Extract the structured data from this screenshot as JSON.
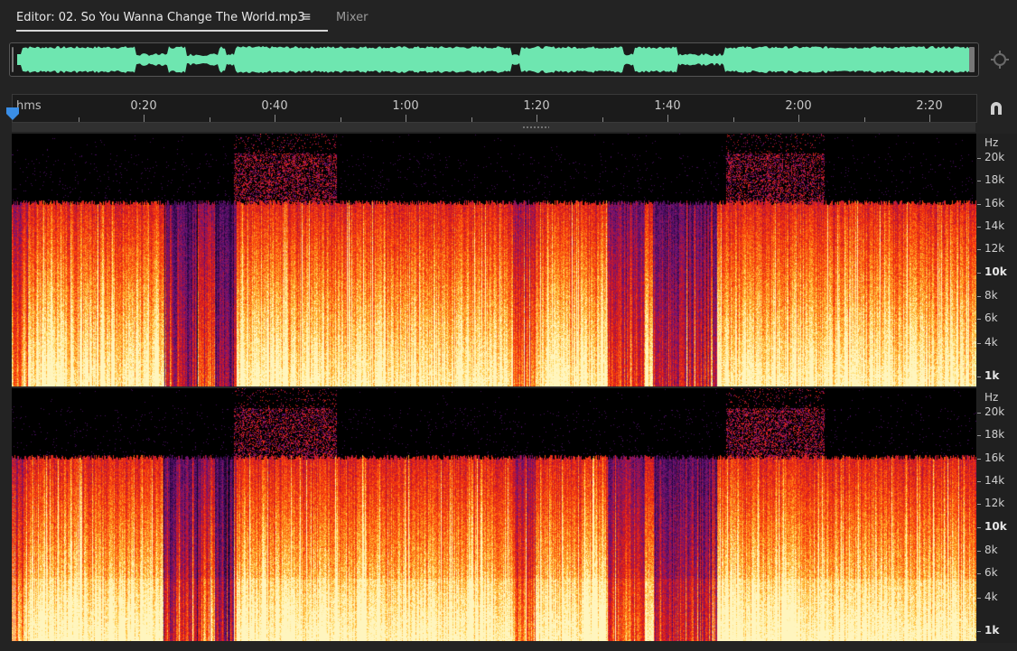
{
  "tabs": {
    "editor_label": "Editor: 02. So You Wanna Change The World.mp3",
    "menu_glyph": "≡",
    "mixer_label": "Mixer"
  },
  "ruler": {
    "unit": "hms",
    "labels": [
      "0:20",
      "0:40",
      "1:00",
      "1:20",
      "1:40",
      "2:00",
      "2:20"
    ]
  },
  "freq_axis": {
    "unit": "Hz",
    "labels": [
      "20k",
      "18k",
      "16k",
      "14k",
      "12k",
      "10k",
      "8k",
      "6k",
      "4k",
      "1k"
    ]
  },
  "icons": {
    "zoom": "zoom-icon",
    "snap": "magnet-icon",
    "playhead": "playhead-icon"
  },
  "colors": {
    "waveform": "#6ee6b0",
    "playhead": "#3a8ee6",
    "background": "#232323",
    "spectrogram_low": "#ffd860",
    "spectrogram_mid": "#ff3020",
    "spectrogram_high": "#5a1a80"
  }
}
